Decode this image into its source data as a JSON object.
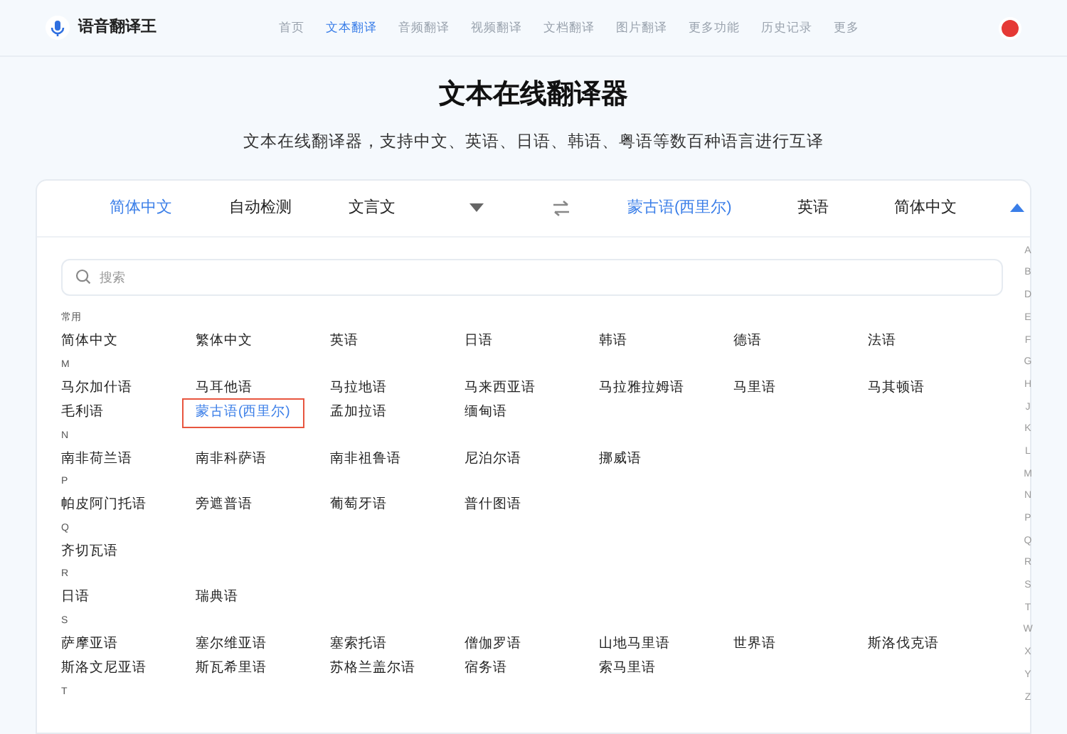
{
  "header": {
    "logo_text": "语音翻译王",
    "nav": [
      {
        "label": "首页",
        "selected": false
      },
      {
        "label": "文本翻译",
        "selected": true
      },
      {
        "label": "音频翻译",
        "selected": false
      },
      {
        "label": "视频翻译",
        "selected": false
      },
      {
        "label": "文档翻译",
        "selected": false
      },
      {
        "label": "图片翻译",
        "selected": false
      },
      {
        "label": "更多功能",
        "selected": false
      },
      {
        "label": "历史记录",
        "selected": false
      },
      {
        "label": "更多",
        "selected": false
      }
    ]
  },
  "hero": {
    "title": "文本在线翻译器",
    "subtitle": "文本在线翻译器，支持中文、英语、日语、韩语、粤语等数百种语言进行互译"
  },
  "language_bar": {
    "source": [
      {
        "label": "简体中文",
        "selected": true
      },
      {
        "label": "自动检测",
        "selected": false
      },
      {
        "label": "文言文",
        "selected": false
      }
    ],
    "target": [
      {
        "label": "蒙古语(西里尔)",
        "selected": true
      },
      {
        "label": "英语",
        "selected": false
      },
      {
        "label": "简体中文",
        "selected": false
      }
    ],
    "expanded": true
  },
  "search": {
    "placeholder": "搜索"
  },
  "groups": [
    {
      "label": "常用",
      "items": [
        {
          "label": "简体中文",
          "selected": false
        },
        {
          "label": "繁体中文",
          "selected": false
        },
        {
          "label": "英语",
          "selected": false
        },
        {
          "label": "日语",
          "selected": false
        },
        {
          "label": "韩语",
          "selected": false
        },
        {
          "label": "德语",
          "selected": false
        },
        {
          "label": "法语",
          "selected": false
        }
      ]
    },
    {
      "label": "M",
      "items": [
        {
          "label": "马尔加什语",
          "selected": false
        },
        {
          "label": "马耳他语",
          "selected": false
        },
        {
          "label": "马拉地语",
          "selected": false
        },
        {
          "label": "马来西亚语",
          "selected": false
        },
        {
          "label": "马拉雅拉姆语",
          "selected": false
        },
        {
          "label": "马里语",
          "selected": false
        },
        {
          "label": "马其顿语",
          "selected": false
        },
        {
          "label": "毛利语",
          "selected": false
        },
        {
          "label": "蒙古语(西里尔)",
          "selected": true
        },
        {
          "label": "孟加拉语",
          "selected": false
        },
        {
          "label": "缅甸语",
          "selected": false
        }
      ]
    },
    {
      "label": "N",
      "items": [
        {
          "label": "南非荷兰语",
          "selected": false
        },
        {
          "label": "南非科萨语",
          "selected": false
        },
        {
          "label": "南非祖鲁语",
          "selected": false
        },
        {
          "label": "尼泊尔语",
          "selected": false
        },
        {
          "label": "挪威语",
          "selected": false
        }
      ]
    },
    {
      "label": "P",
      "items": [
        {
          "label": "帕皮阿门托语",
          "selected": false
        },
        {
          "label": "旁遮普语",
          "selected": false
        },
        {
          "label": "葡萄牙语",
          "selected": false
        },
        {
          "label": "普什图语",
          "selected": false
        }
      ]
    },
    {
      "label": "Q",
      "items": [
        {
          "label": "齐切瓦语",
          "selected": false
        }
      ]
    },
    {
      "label": "R",
      "items": [
        {
          "label": "日语",
          "selected": false
        },
        {
          "label": "瑞典语",
          "selected": false
        }
      ]
    },
    {
      "label": "S",
      "items": [
        {
          "label": "萨摩亚语",
          "selected": false
        },
        {
          "label": "塞尔维亚语",
          "selected": false
        },
        {
          "label": "塞索托语",
          "selected": false
        },
        {
          "label": "僧伽罗语",
          "selected": false
        },
        {
          "label": "山地马里语",
          "selected": false
        },
        {
          "label": "世界语",
          "selected": false
        },
        {
          "label": "斯洛伐克语",
          "selected": false
        },
        {
          "label": "斯洛文尼亚语",
          "selected": false
        },
        {
          "label": "斯瓦希里语",
          "selected": false
        },
        {
          "label": "苏格兰盖尔语",
          "selected": false
        },
        {
          "label": "宿务语",
          "selected": false
        },
        {
          "label": "索马里语",
          "selected": false
        }
      ]
    },
    {
      "label": "T"
    }
  ],
  "index_letters": [
    "A",
    "B",
    "D",
    "E",
    "F",
    "G",
    "H",
    "J",
    "K",
    "L",
    "M",
    "N",
    "P",
    "Q",
    "R",
    "S",
    "T",
    "W",
    "X",
    "Y",
    "Z"
  ]
}
